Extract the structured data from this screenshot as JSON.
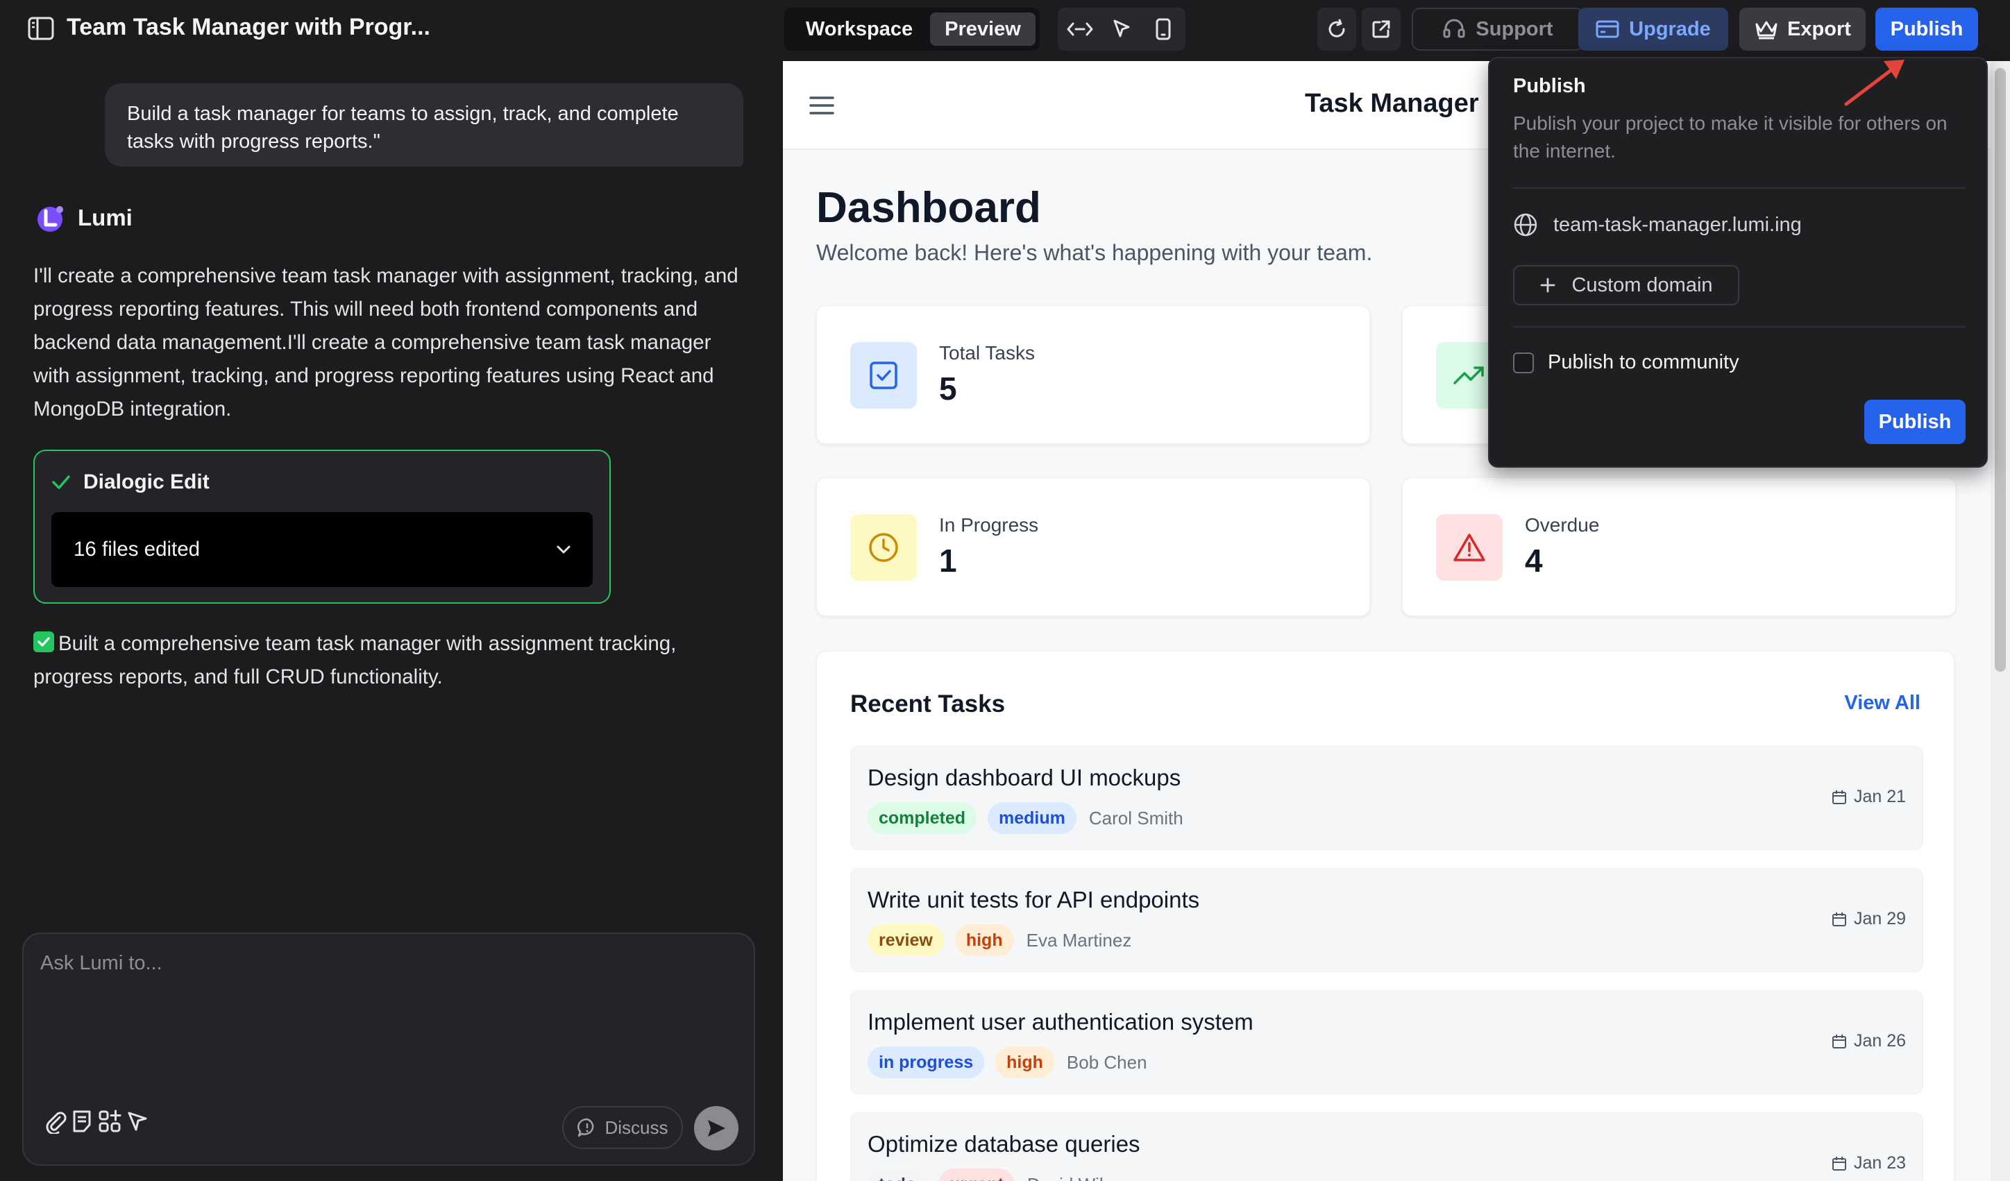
{
  "window": {
    "title": "Team Task Manager with Progr..."
  },
  "topbar": {
    "tabs": [
      {
        "label": "Workspace"
      },
      {
        "label": "Preview"
      }
    ],
    "support_label": "Support",
    "upgrade_label": "Upgrade",
    "export_label": "Export",
    "publish_label": "Publish"
  },
  "chat": {
    "user_message": "Build a task manager for teams to assign, track, and complete tasks with progress reports.\"",
    "assistant_name": "Lumi",
    "assistant_message": "I'll create a comprehensive team task manager with assignment, tracking, and progress reporting features. This will need both frontend components and backend data management.I'll create a comprehensive team task manager with assignment, tracking, and progress reporting features using React and MongoDB integration.",
    "edit_card": {
      "title": "Dialogic Edit",
      "files_label": "16 files edited"
    },
    "summary": "Built a comprehensive team task manager with assignment tracking, progress reports, and full CRUD functionality.",
    "composer": {
      "placeholder": "Ask Lumi to...",
      "discuss_label": "Discuss"
    }
  },
  "preview": {
    "app_title": "Task Manager",
    "dashboard": {
      "title": "Dashboard",
      "subtitle": "Welcome back! Here's what's happening with your team."
    },
    "stats": [
      {
        "label": "Total Tasks",
        "value": "5"
      },
      {
        "label": "In Progress",
        "value": "1"
      },
      {
        "label": "Overdue",
        "value": "4"
      }
    ],
    "recent": {
      "title": "Recent Tasks",
      "view_all": "View All",
      "tasks": [
        {
          "name": "Design dashboard UI mockups",
          "status": "completed",
          "priority": "medium",
          "assignee": "Carol Smith",
          "date": "Jan 21"
        },
        {
          "name": "Write unit tests for API endpoints",
          "status": "review",
          "priority": "high",
          "assignee": "Eva Martinez",
          "date": "Jan 29"
        },
        {
          "name": "Implement user authentication system",
          "status": "in progress",
          "priority": "high",
          "assignee": "Bob Chen",
          "date": "Jan 26"
        },
        {
          "name": "Optimize database queries",
          "status": "todo",
          "priority": "urgent",
          "assignee": "David Wilson",
          "date": "Jan 23"
        }
      ]
    }
  },
  "publish_popover": {
    "title": "Publish",
    "description": "Publish your project to make it visible for others on the internet.",
    "domain": "team-task-manager.lumi.ing",
    "custom_domain_label": "Custom domain",
    "community_label": "Publish to community",
    "community_checked": false,
    "publish_button": "Publish"
  },
  "colors": {
    "accent": "#2563eb",
    "success": "#22c55e",
    "dark_bg": "#1c1c1f",
    "annotation_arrow": "#e5443a"
  },
  "icons": [
    "sidebar-toggle-icon",
    "code-icon",
    "cursor-icon",
    "mobile-icon",
    "refresh-icon",
    "external-link-icon",
    "headset-icon",
    "card-icon",
    "crown-icon",
    "lumi-logo-icon",
    "check-icon",
    "chevron-down-icon",
    "paperclip-icon",
    "note-icon",
    "apps-icon",
    "send-arrow-icon",
    "chat-bubble-icon",
    "send-icon",
    "hamburger-icon",
    "checkbox-icon",
    "trending-up-icon",
    "clock-icon",
    "alert-triangle-icon",
    "calendar-icon",
    "globe-icon",
    "plus-icon"
  ]
}
